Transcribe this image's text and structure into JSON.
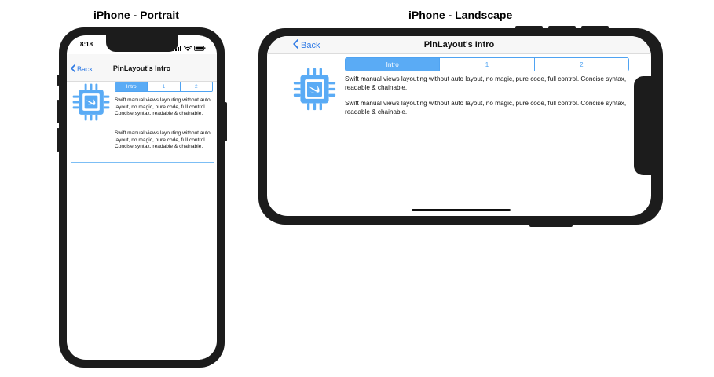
{
  "captions": {
    "portrait": "iPhone - Portrait",
    "landscape": "iPhone - Landscape"
  },
  "status_bar": {
    "time": "8:18"
  },
  "nav": {
    "back_label": "Back",
    "title": "PinLayout's Intro"
  },
  "segments": [
    "Intro",
    "1",
    "2"
  ],
  "selected_segment": "Intro",
  "description": [
    "Swift manual views layouting without auto layout, no magic, pure code, full control. Concise syntax, readable & chainable.",
    "Swift manual views layouting without auto layout, no magic, pure code, full control. Concise syntax, readable & chainable."
  ],
  "icons": {
    "chip": "swift-chip-icon",
    "back": "chevron-left-icon",
    "wifi": "wifi-icon",
    "battery": "battery-icon"
  },
  "colors": {
    "accent": "#5aabf5",
    "link": "#2f7ae5",
    "phone_frame": "#1c1c1c"
  }
}
